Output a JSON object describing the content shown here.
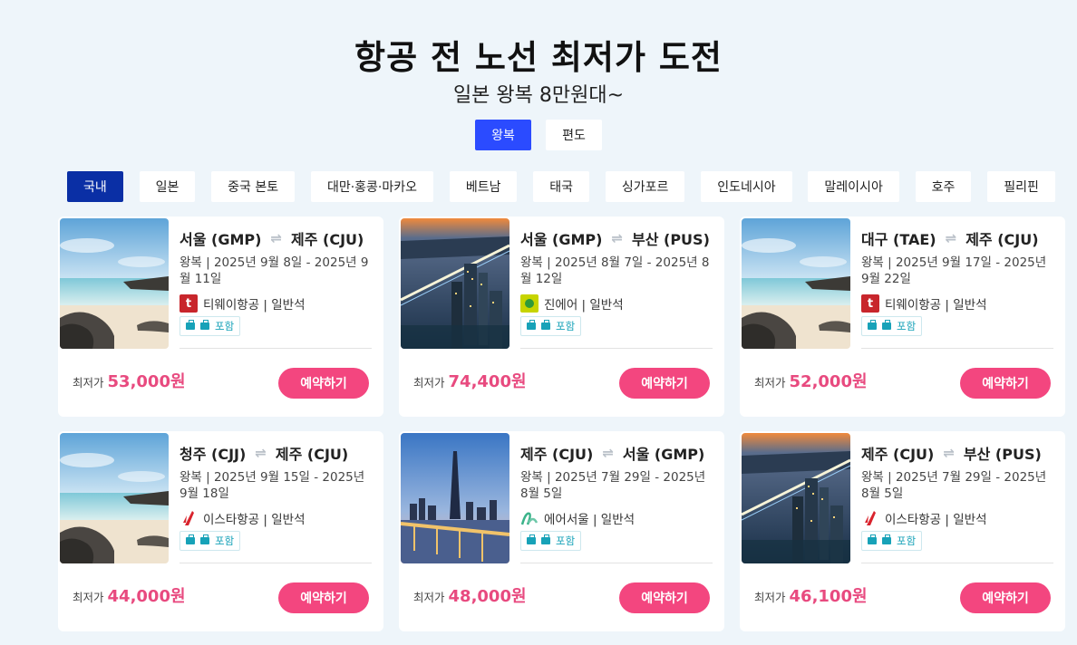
{
  "header": {
    "title": "항공 전 노선 최저가 도전",
    "subtitle": "일본 왕복 8만원대~"
  },
  "trip_types": [
    {
      "label": "왕복",
      "active": true
    },
    {
      "label": "편도",
      "active": false
    }
  ],
  "regions": [
    {
      "label": "국내",
      "active": true
    },
    {
      "label": "일본"
    },
    {
      "label": "중국 본토"
    },
    {
      "label": "대만·홍콩·마카오"
    },
    {
      "label": "베트남"
    },
    {
      "label": "태국"
    },
    {
      "label": "싱가포르"
    },
    {
      "label": "인도네시아"
    },
    {
      "label": "말레이시아"
    },
    {
      "label": "호주"
    },
    {
      "label": "필리핀"
    }
  ],
  "labels": {
    "baggage": "포함",
    "price_prefix": "최저가",
    "book_button": "예약하기"
  },
  "cards": [
    {
      "from": "서울 (GMP)",
      "to": "제주 (CJU)",
      "dates": "왕복 | 2025년 9월 8일 - 2025년 9월 11일",
      "airline": "티웨이항공 | 일반석",
      "airline_logo": "tway-logo",
      "price": "53,000원",
      "image": "beach-rocks"
    },
    {
      "from": "서울 (GMP)",
      "to": "부산 (PUS)",
      "dates": "왕복 | 2025년 8월 7일 - 2025년 8월 12일",
      "airline": "진에어 | 일반석",
      "airline_logo": "jinair-logo",
      "price": "74,400원",
      "image": "city-bridge-night"
    },
    {
      "from": "대구 (TAE)",
      "to": "제주 (CJU)",
      "dates": "왕복 | 2025년 9월 17일 - 2025년 9월 22일",
      "airline": "티웨이항공 | 일반석",
      "airline_logo": "tway-logo",
      "price": "52,000원",
      "image": "beach-rocks"
    },
    {
      "from": "청주 (CJJ)",
      "to": "제주 (CJU)",
      "dates": "왕복 | 2025년 9월 15일 - 2025년 9월 18일",
      "airline": "이스타항공 | 일반석",
      "airline_logo": "eastar-logo",
      "price": "44,000원",
      "image": "beach-rocks"
    },
    {
      "from": "제주 (CJU)",
      "to": "서울 (GMP)",
      "dates": "왕복 | 2025년 7월 29일 - 2025년 8월 5일",
      "airline": "에어서울 | 일반석",
      "airline_logo": "airseoul-logo",
      "price": "48,000원",
      "image": "seoul-tower-bridge"
    },
    {
      "from": "제주 (CJU)",
      "to": "부산 (PUS)",
      "dates": "왕복 | 2025년 7월 29일 - 2025년 8월 5일",
      "airline": "이스타항공 | 일반석",
      "airline_logo": "eastar-logo",
      "price": "46,100원",
      "image": "city-bridge-night"
    }
  ],
  "colors": {
    "background": "#eef5fa",
    "trip_active": "#2b4bff",
    "region_active": "#0a2fa5",
    "price": "#e84a7f",
    "button": "#f3467f",
    "baggage": "#17a2b8"
  }
}
